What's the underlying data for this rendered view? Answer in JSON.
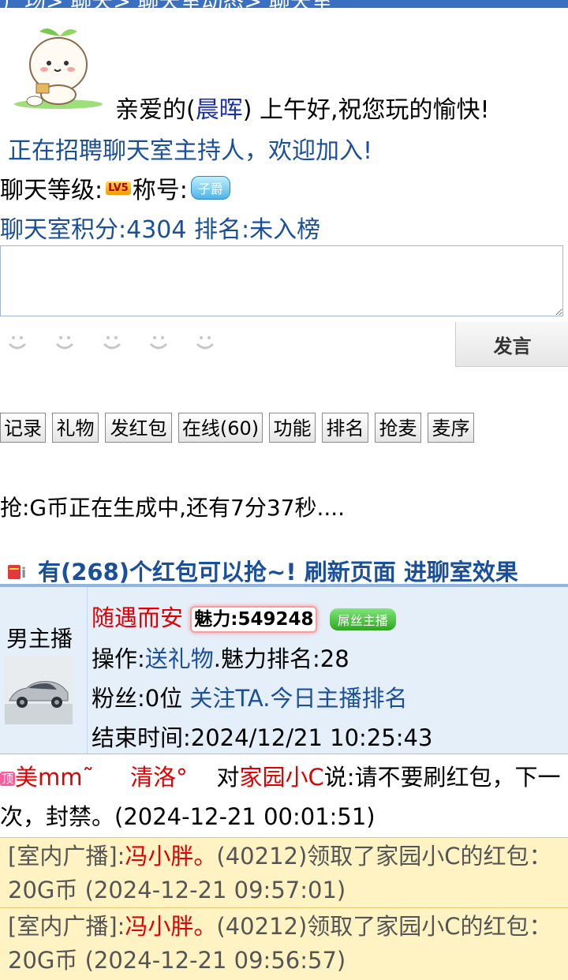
{
  "breadcrumb": "广场> 聊天> 聊天室动态> 聊天室",
  "greeting": {
    "prefix": "亲爱的(",
    "username": "晨晖",
    "suffix": ") 上午好,祝您玩的愉快!"
  },
  "recruit_text": "正在招聘聊天室主持人，欢迎加入!",
  "level": {
    "label": "聊天等级:",
    "badge": "LV5",
    "title_label": "称号:",
    "title_badge": "子爵"
  },
  "points": {
    "label": "聊天室积分:",
    "value": "4304",
    "rank_label": " 排名:",
    "rank_value": "未入榜"
  },
  "message_input": {
    "placeholder": ""
  },
  "emojis": [
    "smile-icon",
    "smile-icon",
    "smile-icon",
    "smile-icon",
    "smile-icon"
  ],
  "send_label": "发言",
  "buttons": [
    "记录",
    "礼物",
    "发红包",
    "在线(60)",
    "功能",
    "排名",
    "抢麦",
    "麦序"
  ],
  "grab_status": "抢:G币正在生成中,还有7分37秒....",
  "red_packet": {
    "text_1": "有(268)个红包可以抢~!",
    "refresh": "刷新页面",
    "effect": "进聊室效果"
  },
  "anchor": {
    "role": "男主播",
    "name": "随遇而安",
    "charm_label": "魅力:",
    "charm_value": "549248",
    "badge": "屌丝主播",
    "op_label": "操作:",
    "send_gift": "送礼物",
    "charm_rank_label": ".魅力排名:",
    "charm_rank_value": "28",
    "fans_label": "粉丝:",
    "fans_value": "0位",
    "follow": "关注TA",
    "today_rank": ".今日主播排名",
    "end_label": "结束时间:",
    "end_time": "2024/12/21 10:25:43"
  },
  "chat": {
    "vip": "顶",
    "sender": "美mm˜",
    "sender2": "清洛°",
    "to_prefix": "对",
    "target": "家园小C",
    "text": "说:请不要刷红包，下一次，封禁。(2024-12-21 00:01:51)"
  },
  "broadcasts": [
    {
      "prefix": "[室内广播]:",
      "who": "冯小胖。",
      "text": "(40212)领取了家园小C的红包：20G币 (2024-12-21 09:57:01)"
    },
    {
      "prefix": "[室内广播]:",
      "who": "冯小胖。",
      "text": "(40212)领取了家园小C的红包：20G币 (2024-12-21 09:56:57)"
    }
  ],
  "colors": {
    "link_blue": "#1a4f9c",
    "alert_red": "#e00000",
    "broadcast_bg": "#fff3c4",
    "anchor_bg": "#e5effa"
  }
}
